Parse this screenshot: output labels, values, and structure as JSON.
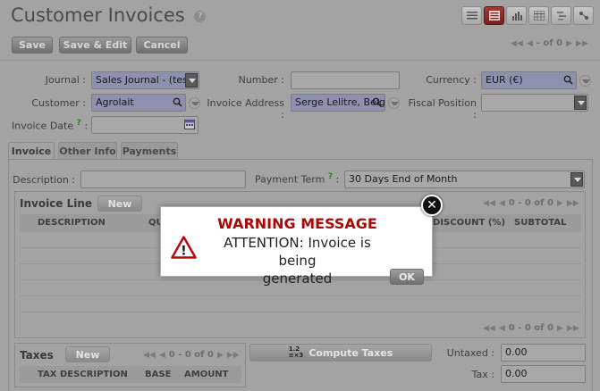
{
  "header": {
    "title": "Customer Invoices",
    "help_glyph": "?",
    "view_icons": [
      "list-view-icon",
      "form-view-icon",
      "graph-view-icon",
      "calendar-view-icon",
      "gantt-view-icon"
    ]
  },
  "toolbar": {
    "save_label": "Save",
    "save_edit_label": "Save & Edit",
    "cancel_label": "Cancel",
    "pager_text": "- of 0"
  },
  "form": {
    "journal_label": "Journal :",
    "journal_value": "Sales Journal - (test",
    "number_label": "Number :",
    "number_value": "",
    "currency_label": "Currency :",
    "currency_value": "EUR (€)",
    "customer_label": "Customer :",
    "customer_value": "Agrolait",
    "invoice_address_label": "Invoice Address :",
    "invoice_address_value": "Serge Lelitre, Belg",
    "fiscal_position_label": "Fiscal Position :",
    "fiscal_position_value": "",
    "invoice_date_label": "Invoice Date",
    "invoice_date_help": "?",
    "invoice_date_colon": ":",
    "invoice_date_value": ""
  },
  "tabs": [
    {
      "label": "Invoice"
    },
    {
      "label": "Other Info"
    },
    {
      "label": "Payments"
    }
  ],
  "invoice_tab": {
    "description_label": "Description :",
    "description_value": "",
    "payment_term_label": "Payment Term",
    "payment_term_help": "?",
    "payment_term_colon": ":",
    "payment_term_value": "30 Days End of Month",
    "invoice_line": {
      "title": "Invoice Line",
      "new_label": "New",
      "pager_text": "0 - 0 of 0",
      "columns": [
        "DESCRIPTION",
        "QU",
        "DISCOUNT (%)",
        "SUBTOTAL"
      ],
      "bottom_pager_text": "0 - 0 of 0"
    },
    "taxes": {
      "title": "Taxes",
      "new_label": "New",
      "pager_text": "0 - 0 of 0",
      "columns": [
        "TAX DESCRIPTION",
        "BASE",
        "AMOUNT"
      ]
    },
    "compute_taxes_label": "Compute Taxes",
    "compute_icon_text": "1.2\n≡×3",
    "untaxed_label": "Untaxed :",
    "untaxed_value": "0.00",
    "tax_label": "Tax :",
    "tax_value": "0.00"
  },
  "modal": {
    "title": "WARNING MESSAGE",
    "message_line1": "ATTENTION: Invoice is being",
    "message_line2": "generated",
    "ok_label": "OK",
    "close_glyph": "✕",
    "warning_glyph": "!"
  },
  "colors": {
    "overlay_bg": "#a3a3a3",
    "warning_red": "#a80a0a",
    "required_field": "#8f8fb0",
    "active_view": "#7a1f1f"
  }
}
